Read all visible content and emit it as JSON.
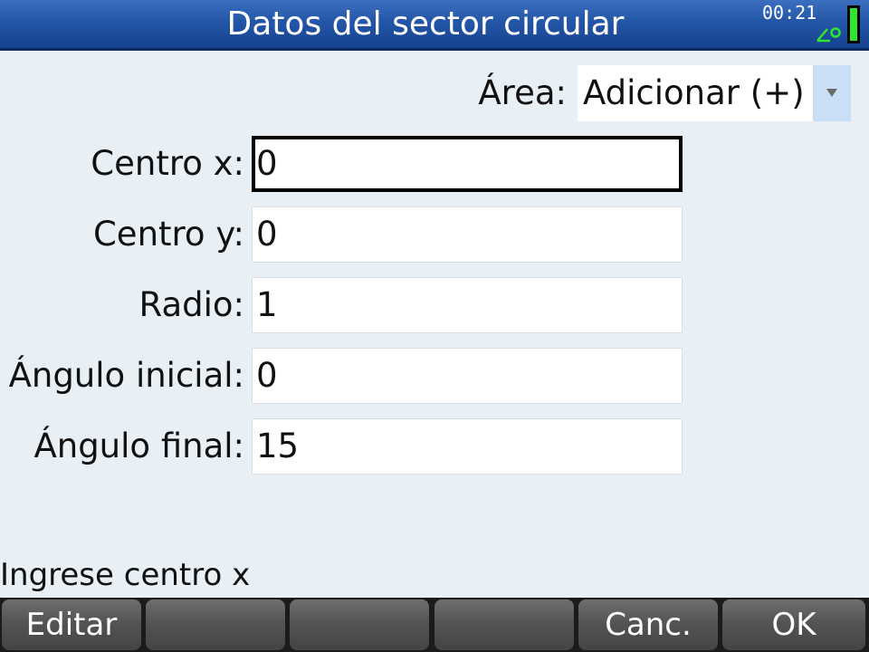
{
  "header": {
    "title": "Datos del sector circular",
    "clock": "00:21",
    "angle_indicator_icon": "angle-degree-icon",
    "battery_icon": "battery-icon",
    "colors": {
      "title_bar": "#2456a8",
      "battery": "#2fe52f",
      "angle_indicator": "#2fe52f"
    }
  },
  "form": {
    "area": {
      "label": "Área:",
      "selected": "Adicionar (+)"
    },
    "fields": [
      {
        "label": "Centro x:",
        "value": "0"
      },
      {
        "label": "Centro y:",
        "value": "0"
      },
      {
        "label": "Radio:",
        "value": "1"
      },
      {
        "label": "Ángulo inicial:",
        "value": "0"
      },
      {
        "label": "Ángulo final:",
        "value": "15"
      }
    ]
  },
  "help_text": "Ingrese centro x",
  "softkeys": [
    {
      "label": "Editar"
    },
    {
      "label": ""
    },
    {
      "label": ""
    },
    {
      "label": ""
    },
    {
      "label": "Canc."
    },
    {
      "label": "OK"
    }
  ]
}
